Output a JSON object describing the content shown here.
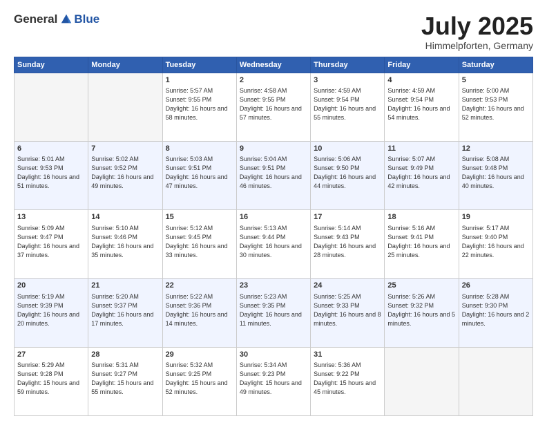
{
  "header": {
    "logo_general": "General",
    "logo_blue": "Blue",
    "title": "July 2025",
    "location": "Himmelpforten, Germany"
  },
  "weekdays": [
    "Sunday",
    "Monday",
    "Tuesday",
    "Wednesday",
    "Thursday",
    "Friday",
    "Saturday"
  ],
  "weeks": [
    [
      {
        "day": "",
        "empty": true
      },
      {
        "day": "",
        "empty": true
      },
      {
        "day": "1",
        "sunrise": "5:57 AM",
        "sunset": "9:55 PM",
        "daylight": "16 hours and 58 minutes."
      },
      {
        "day": "2",
        "sunrise": "4:58 AM",
        "sunset": "9:55 PM",
        "daylight": "16 hours and 57 minutes."
      },
      {
        "day": "3",
        "sunrise": "4:59 AM",
        "sunset": "9:54 PM",
        "daylight": "16 hours and 55 minutes."
      },
      {
        "day": "4",
        "sunrise": "4:59 AM",
        "sunset": "9:54 PM",
        "daylight": "16 hours and 54 minutes."
      },
      {
        "day": "5",
        "sunrise": "5:00 AM",
        "sunset": "9:53 PM",
        "daylight": "16 hours and 52 minutes."
      }
    ],
    [
      {
        "day": "6",
        "sunrise": "5:01 AM",
        "sunset": "9:53 PM",
        "daylight": "16 hours and 51 minutes."
      },
      {
        "day": "7",
        "sunrise": "5:02 AM",
        "sunset": "9:52 PM",
        "daylight": "16 hours and 49 minutes."
      },
      {
        "day": "8",
        "sunrise": "5:03 AM",
        "sunset": "9:51 PM",
        "daylight": "16 hours and 47 minutes."
      },
      {
        "day": "9",
        "sunrise": "5:04 AM",
        "sunset": "9:51 PM",
        "daylight": "16 hours and 46 minutes."
      },
      {
        "day": "10",
        "sunrise": "5:06 AM",
        "sunset": "9:50 PM",
        "daylight": "16 hours and 44 minutes."
      },
      {
        "day": "11",
        "sunrise": "5:07 AM",
        "sunset": "9:49 PM",
        "daylight": "16 hours and 42 minutes."
      },
      {
        "day": "12",
        "sunrise": "5:08 AM",
        "sunset": "9:48 PM",
        "daylight": "16 hours and 40 minutes."
      }
    ],
    [
      {
        "day": "13",
        "sunrise": "5:09 AM",
        "sunset": "9:47 PM",
        "daylight": "16 hours and 37 minutes."
      },
      {
        "day": "14",
        "sunrise": "5:10 AM",
        "sunset": "9:46 PM",
        "daylight": "16 hours and 35 minutes."
      },
      {
        "day": "15",
        "sunrise": "5:12 AM",
        "sunset": "9:45 PM",
        "daylight": "16 hours and 33 minutes."
      },
      {
        "day": "16",
        "sunrise": "5:13 AM",
        "sunset": "9:44 PM",
        "daylight": "16 hours and 30 minutes."
      },
      {
        "day": "17",
        "sunrise": "5:14 AM",
        "sunset": "9:43 PM",
        "daylight": "16 hours and 28 minutes."
      },
      {
        "day": "18",
        "sunrise": "5:16 AM",
        "sunset": "9:41 PM",
        "daylight": "16 hours and 25 minutes."
      },
      {
        "day": "19",
        "sunrise": "5:17 AM",
        "sunset": "9:40 PM",
        "daylight": "16 hours and 22 minutes."
      }
    ],
    [
      {
        "day": "20",
        "sunrise": "5:19 AM",
        "sunset": "9:39 PM",
        "daylight": "16 hours and 20 minutes."
      },
      {
        "day": "21",
        "sunrise": "5:20 AM",
        "sunset": "9:37 PM",
        "daylight": "16 hours and 17 minutes."
      },
      {
        "day": "22",
        "sunrise": "5:22 AM",
        "sunset": "9:36 PM",
        "daylight": "16 hours and 14 minutes."
      },
      {
        "day": "23",
        "sunrise": "5:23 AM",
        "sunset": "9:35 PM",
        "daylight": "16 hours and 11 minutes."
      },
      {
        "day": "24",
        "sunrise": "5:25 AM",
        "sunset": "9:33 PM",
        "daylight": "16 hours and 8 minutes."
      },
      {
        "day": "25",
        "sunrise": "5:26 AM",
        "sunset": "9:32 PM",
        "daylight": "16 hours and 5 minutes."
      },
      {
        "day": "26",
        "sunrise": "5:28 AM",
        "sunset": "9:30 PM",
        "daylight": "16 hours and 2 minutes."
      }
    ],
    [
      {
        "day": "27",
        "sunrise": "5:29 AM",
        "sunset": "9:28 PM",
        "daylight": "15 hours and 59 minutes."
      },
      {
        "day": "28",
        "sunrise": "5:31 AM",
        "sunset": "9:27 PM",
        "daylight": "15 hours and 55 minutes."
      },
      {
        "day": "29",
        "sunrise": "5:32 AM",
        "sunset": "9:25 PM",
        "daylight": "15 hours and 52 minutes."
      },
      {
        "day": "30",
        "sunrise": "5:34 AM",
        "sunset": "9:23 PM",
        "daylight": "15 hours and 49 minutes."
      },
      {
        "day": "31",
        "sunrise": "5:36 AM",
        "sunset": "9:22 PM",
        "daylight": "15 hours and 45 minutes."
      },
      {
        "day": "",
        "empty": true
      },
      {
        "day": "",
        "empty": true
      }
    ]
  ]
}
